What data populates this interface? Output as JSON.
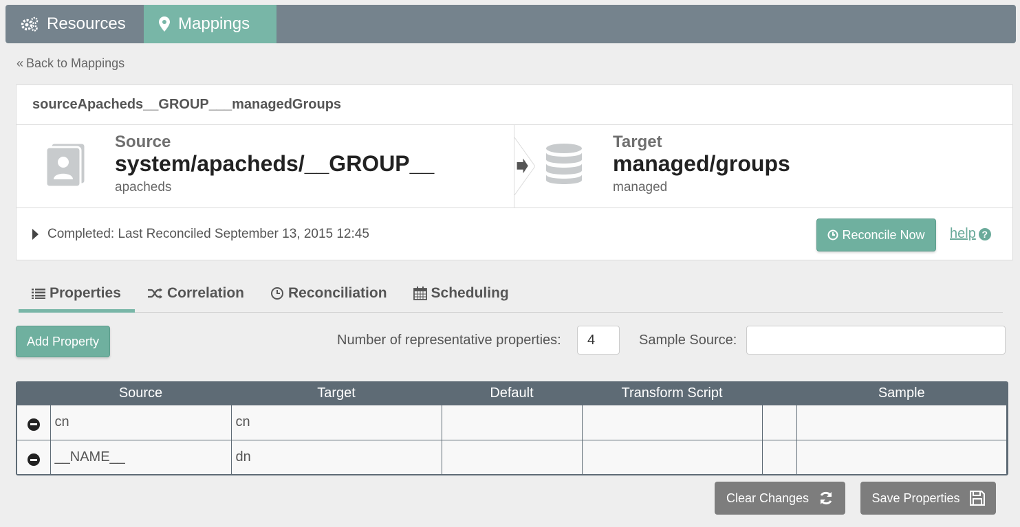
{
  "nav": {
    "tabs": [
      {
        "label": "Resources",
        "icon": "gears-icon"
      },
      {
        "label": "Mappings",
        "icon": "map-marker-icon",
        "active": true
      }
    ]
  },
  "back_link": "Back to Mappings",
  "mapping": {
    "title": "sourceApacheds__GROUP___managedGroups",
    "source": {
      "label": "Source",
      "name": "system/apacheds/__GROUP__",
      "sub": "apacheds"
    },
    "target": {
      "label": "Target",
      "name": "managed/groups",
      "sub": "managed"
    },
    "status": "Completed: Last Reconciled September 13, 2015 12:45",
    "reconcile_label": "Reconcile Now",
    "help_label": "help"
  },
  "tabs": [
    {
      "label": "Properties",
      "icon": "list-icon",
      "active": true
    },
    {
      "label": "Correlation",
      "icon": "shuffle-icon"
    },
    {
      "label": "Reconciliation",
      "icon": "clock-icon"
    },
    {
      "label": "Scheduling",
      "icon": "calendar-icon"
    }
  ],
  "toolbar": {
    "add_label": "Add Property",
    "num_label": "Number of representative properties:",
    "num_value": "4",
    "sample_label": "Sample Source:",
    "sample_value": ""
  },
  "grid": {
    "headers": [
      "",
      "Source",
      "Target",
      "Default",
      "Transform Script",
      "",
      "Sample"
    ],
    "rows": [
      {
        "source": "cn",
        "target": "cn",
        "default": "",
        "transform": "",
        "extra": "",
        "sample": ""
      },
      {
        "source": "__NAME__",
        "target": "dn",
        "default": "",
        "transform": "",
        "extra": "",
        "sample": ""
      }
    ]
  },
  "footer": {
    "clear_label": "Clear Changes",
    "save_label": "Save Properties"
  },
  "colors": {
    "accent": "#78b6a7",
    "nav": "#75838d",
    "grid_header": "#5e6b75",
    "button_gray": "#7d7d7d"
  }
}
